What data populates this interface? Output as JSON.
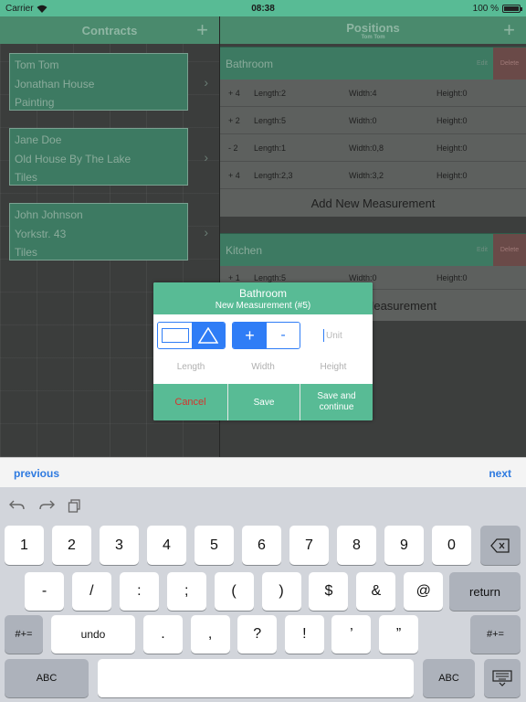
{
  "status": {
    "carrier": "Carrier",
    "time": "08:38",
    "battery": "100 %",
    "battery_level": 1.0
  },
  "left": {
    "title": "Contracts",
    "add_symbol": "+",
    "contracts": [
      {
        "name": "Tom Tom",
        "project": "Jonathan House",
        "trade": "Painting"
      },
      {
        "name": "Jane Doe",
        "project": "Old House By The Lake",
        "trade": "Tiles"
      },
      {
        "name": "John Johnson",
        "project": "Yorkstr. 43",
        "trade": "Tiles"
      }
    ]
  },
  "right": {
    "title": "Positions",
    "subtitle": "Tom Tom",
    "add_symbol": "+",
    "sections": [
      {
        "name": "Bathroom",
        "edit": "Edit",
        "delete": "Delete",
        "rows": [
          {
            "qty": "+ 4",
            "length": "Length:2",
            "width": "Width:4",
            "height": "Height:0"
          },
          {
            "qty": "+ 2",
            "length": "Length:5",
            "width": "Width:0",
            "height": "Height:0"
          },
          {
            "qty": "- 2",
            "length": "Length:1",
            "width": "Width:0,8",
            "height": "Height:0"
          },
          {
            "qty": "+ 4",
            "length": "Length:2,3",
            "width": "Width:3,2",
            "height": "Height:0"
          }
        ],
        "add_label": "Add New Measurement"
      },
      {
        "name": "Kitchen",
        "edit": "Edit",
        "delete": "Delete",
        "rows": [
          {
            "qty": "+ 1",
            "length": "Length:5",
            "width": "Width:0",
            "height": "Height:0"
          }
        ],
        "add_label": "Add New Measurement"
      }
    ]
  },
  "dialog": {
    "title": "Bathroom",
    "subtitle": "New Measurement (#5)",
    "plus": "+",
    "minus": "-",
    "unit_placeholder": "Unit",
    "labels": {
      "length": "Length",
      "width": "Width",
      "height": "Height"
    },
    "buttons": {
      "cancel": "Cancel",
      "save": "Save",
      "save_continue_1": "Save and",
      "save_continue_2": "continue"
    }
  },
  "accessory": {
    "previous": "previous",
    "next": "next"
  },
  "keyboard": {
    "row1": [
      "1",
      "2",
      "3",
      "4",
      "5",
      "6",
      "7",
      "8",
      "9",
      "0"
    ],
    "row2": [
      "-",
      "/",
      ":",
      ";",
      "(",
      ")",
      "$",
      "&",
      "@"
    ],
    "row3": [
      ".",
      ",",
      "?",
      "!",
      "’",
      "”"
    ],
    "return": "return",
    "symbols": "#+=",
    "undo": "undo",
    "abc": "ABC"
  }
}
